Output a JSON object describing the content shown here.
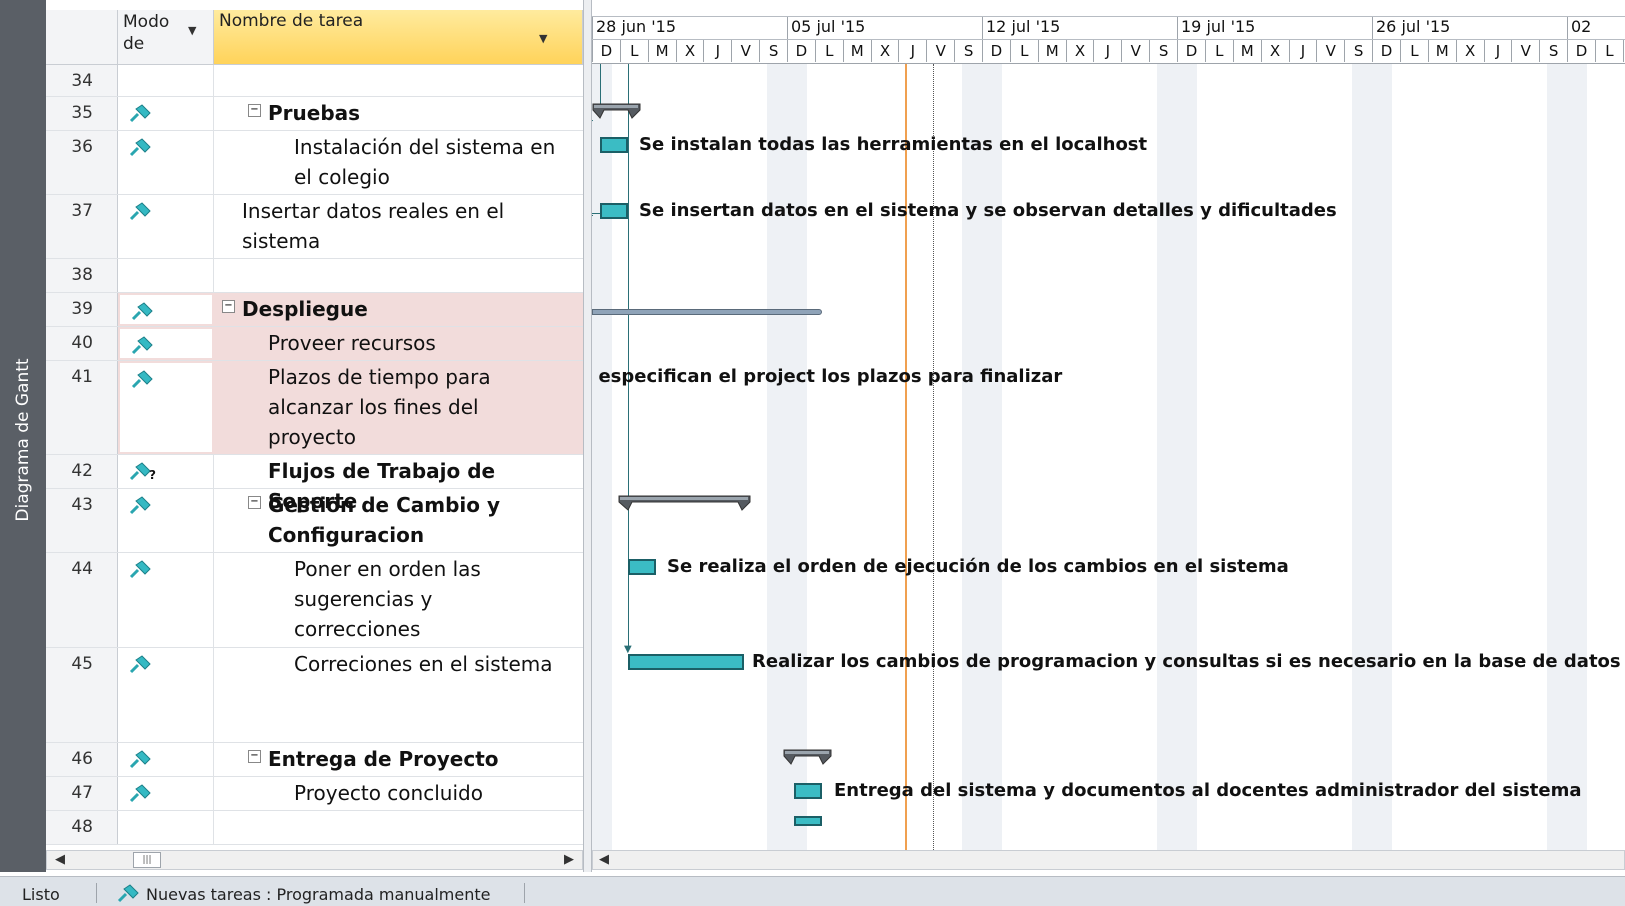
{
  "side_label": "Diagrama de Gantt",
  "columns": {
    "mode": "Modo de",
    "task_name": "Nombre de tarea"
  },
  "rows": [
    {
      "id": "34",
      "name": ""
    },
    {
      "id": "35",
      "name": "Pruebas"
    },
    {
      "id": "36",
      "name": "Instalación del sistema en el colegio"
    },
    {
      "id": "37",
      "name": "Insertar datos reales en el sistema"
    },
    {
      "id": "38",
      "name": ""
    },
    {
      "id": "39",
      "name": "Despliegue"
    },
    {
      "id": "40",
      "name": "Proveer recursos"
    },
    {
      "id": "41",
      "name": "Plazos de tiempo para alcanzar los fines del proyecto"
    },
    {
      "id": "42",
      "name": "Flujos de Trabajo de Soporte"
    },
    {
      "id": "43",
      "name": "Gestion de Cambio y Configuracion"
    },
    {
      "id": "44",
      "name": "Poner en orden las sugerencias y correcciones"
    },
    {
      "id": "45",
      "name": "Correciones en el sistema"
    },
    {
      "id": "46",
      "name": "Entrega de Proyecto"
    },
    {
      "id": "47",
      "name": "Proyecto concluido"
    },
    {
      "id": "48",
      "name": ""
    }
  ],
  "weeks": [
    "28 jun '15",
    "05 jul '15",
    "12 jul '15",
    "19 jul '15",
    "26 jul '15",
    "02"
  ],
  "days": [
    "D",
    "L",
    "M",
    "X",
    "J",
    "V",
    "S"
  ],
  "bar_labels": [
    "Se instalan todas las herramientas en el localhost",
    "Se insertan datos en el sistema y se observan detalles y dificultades",
    "e especifican el project los plazos para finalizar",
    "Se realiza el orden de ejecución de los cambios en el sistema",
    "Realizar los cambios de programacion y consultas si es necesario en la base de datos",
    "Entrega del sistema y documentos al docentes administrador del sistema"
  ],
  "status": {
    "ready": "Listo",
    "new_tasks": "Nuevas tareas : Programada manualmente"
  },
  "colors": {
    "task_bar": "#3bbcc4",
    "summary_bar": "#555a60",
    "status_date": "#f0a050"
  }
}
